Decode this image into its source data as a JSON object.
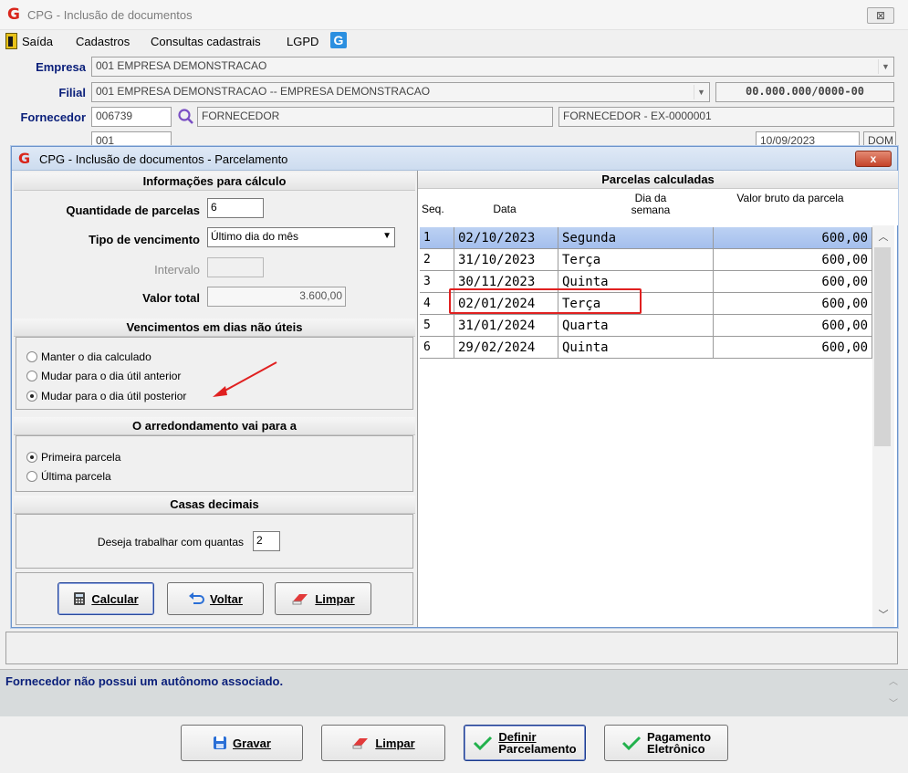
{
  "main": {
    "title": "CPG - Inclusão de documentos",
    "close": "⊠",
    "menu": [
      "Saída",
      "Cadastros",
      "Consultas cadastrais",
      "LGPD"
    ],
    "empresa_label": "Empresa",
    "empresa_value": "001 EMPRESA DEMONSTRACAO",
    "filial_label": "Filial",
    "filial_value": "001 EMPRESA DEMONSTRACAO -- EMPRESA DEMONSTRACAO",
    "cnpj": "00.000.000/0000-00",
    "fornecedor_label": "Fornecedor",
    "fornecedor_code": "006739",
    "fornecedor_name": "FORNECEDOR",
    "fornecedor_desc": "FORNECEDOR - EX-0000001",
    "serie_value": "001",
    "date_value": "10/09/2023",
    "dom_value": "DOM",
    "status_message": "Fornecedor não possui um autônomo associado.",
    "buttons": {
      "gravar": "Gravar",
      "limpar": "Limpar",
      "definir_line1": "Definir",
      "definir_line2": "Parcelamento",
      "pagamento_line1": "Pagamento",
      "pagamento_line2": "Eletrônico"
    }
  },
  "dialog": {
    "title": "CPG - Inclusão de documentos - Parcelamento",
    "close": "x",
    "info_header": "Informações para cálculo",
    "qtd_label": "Quantidade de parcelas",
    "qtd_value": "6",
    "tipo_label": "Tipo de vencimento",
    "tipo_value": "Último dia do mês",
    "intervalo_label": "Intervalo",
    "intervalo_value": "",
    "valor_label": "Valor total",
    "valor_value": "3.600,00",
    "venc_header": "Vencimentos em dias não úteis",
    "venc_options": [
      "Manter o dia calculado",
      "Mudar para o dia útil anterior",
      "Mudar para o dia útil posterior"
    ],
    "venc_selected": 2,
    "arred_header": "O arredondamento vai para a",
    "arred_options": [
      "Primeira parcela",
      "Última parcela"
    ],
    "arred_selected": 0,
    "casas_header": "Casas decimais",
    "casas_label": "Deseja trabalhar com quantas",
    "casas_value": "2",
    "btn_calcular": "Calcular",
    "btn_voltar": "Voltar",
    "btn_limpar": "Limpar"
  },
  "table": {
    "title": "Parcelas calculadas",
    "headers": {
      "seq": "Seq.",
      "data": "Data",
      "dia_line1": "Dia da",
      "dia_line2": "semana",
      "valor": "Valor bruto da parcela"
    },
    "rows": [
      {
        "seq": "1",
        "data": "02/10/2023",
        "dia": "Segunda",
        "valor": "600,00"
      },
      {
        "seq": "2",
        "data": "31/10/2023",
        "dia": "Terça",
        "valor": "600,00"
      },
      {
        "seq": "3",
        "data": "30/11/2023",
        "dia": "Quinta",
        "valor": "600,00"
      },
      {
        "seq": "4",
        "data": "02/01/2024",
        "dia": "Terça",
        "valor": "600,00"
      },
      {
        "seq": "5",
        "data": "31/01/2024",
        "dia": "Quarta",
        "valor": "600,00"
      },
      {
        "seq": "6",
        "data": "29/02/2024",
        "dia": "Quinta",
        "valor": "600,00"
      }
    ],
    "selected_row": 0,
    "highlighted_row": 3
  },
  "colors": {
    "accent_red": "#e02020",
    "label_blue": "#0a1f7a",
    "selection": "#a4bfed"
  }
}
